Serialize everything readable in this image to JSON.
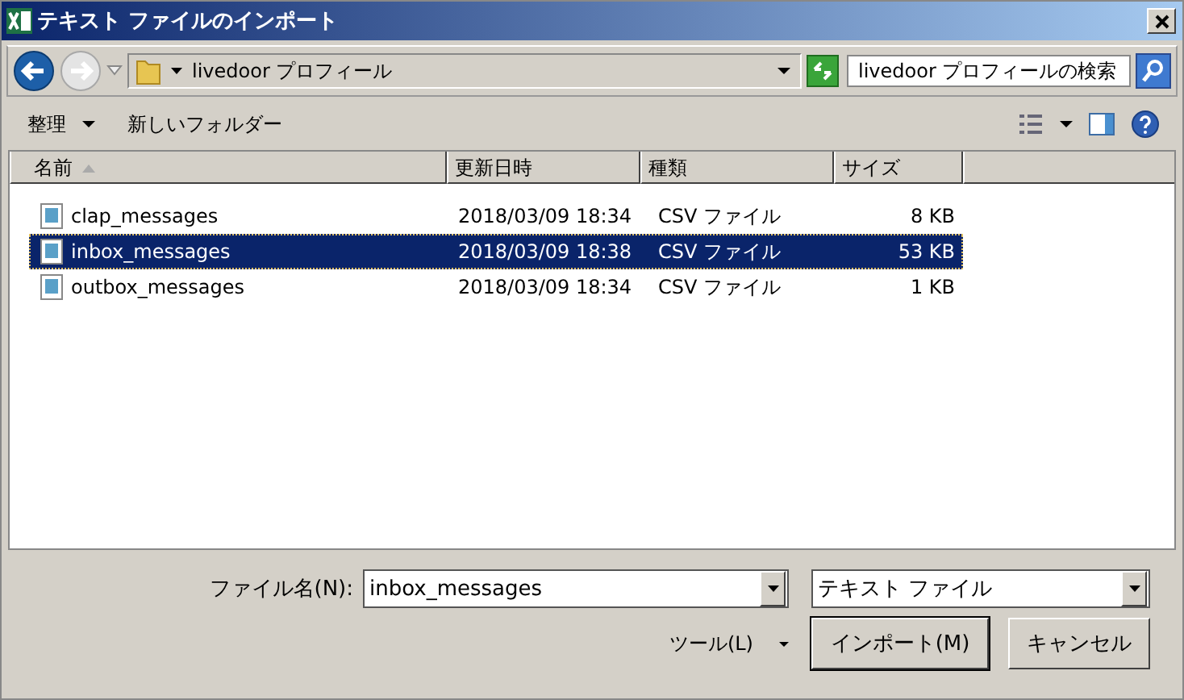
{
  "window": {
    "title": "テキスト ファイルのインポート"
  },
  "address": {
    "path": "livedoor プロフィール",
    "search_placeholder": "livedoor プロフィールの検索"
  },
  "toolbar": {
    "organize": "整理",
    "new_folder": "新しいフォルダー"
  },
  "table": {
    "columns": [
      {
        "label": "名前",
        "sorted": true
      },
      {
        "label": "更新日時",
        "sorted": false
      },
      {
        "label": "種類",
        "sorted": false
      },
      {
        "label": "サイズ",
        "sorted": false
      }
    ],
    "rows": [
      {
        "name": "clap_messages",
        "modified": "2018/03/09 18:34",
        "type": "CSV ファイル",
        "size": "8 KB",
        "selected": false
      },
      {
        "name": "inbox_messages",
        "modified": "2018/03/09 18:38",
        "type": "CSV ファイル",
        "size": "53 KB",
        "selected": true
      },
      {
        "name": "outbox_messages",
        "modified": "2018/03/09 18:34",
        "type": "CSV ファイル",
        "size": "1 KB",
        "selected": false
      }
    ]
  },
  "footer": {
    "filename_label": "ファイル名(N):",
    "filename": "inbox_messages",
    "filetype": "テキスト ファイル",
    "tools": "ツール(L)",
    "import_button": "インポート(M)",
    "cancel_button": "キャンセル"
  }
}
